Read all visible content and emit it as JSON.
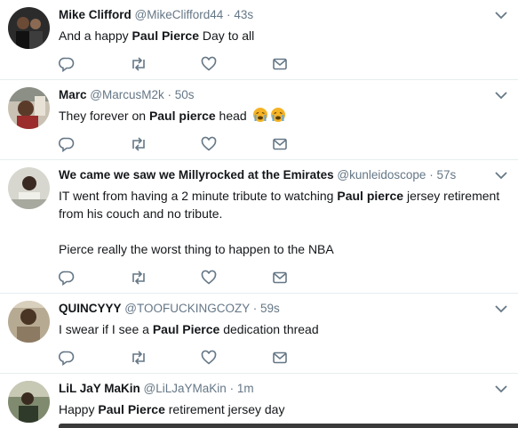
{
  "tweets": [
    {
      "name": "Mike Clifford",
      "handle": "@MikeClifford44",
      "time": "43s",
      "segments": [
        {
          "text": "And a happy ",
          "bold": false
        },
        {
          "text": "Paul Pierce",
          "bold": true
        },
        {
          "text": " Day to all",
          "bold": false
        }
      ]
    },
    {
      "name": "Marc",
      "handle": "@MarcusM2k",
      "time": "50s",
      "segments": [
        {
          "text": "They forever on ",
          "bold": false
        },
        {
          "text": "Paul pierce",
          "bold": true
        },
        {
          "text": " head ",
          "bold": false
        }
      ],
      "emojis": [
        "crying-face-emoji",
        "crying-face-emoji"
      ]
    },
    {
      "name": "We came we saw we Millyrocked at the Emirates",
      "handle": "@kunleidoscope",
      "time": "57s",
      "segments": [
        {
          "text": "IT went from having a 2 minute tribute to watching ",
          "bold": false
        },
        {
          "text": "Paul pierce",
          "bold": true
        },
        {
          "text": " jersey retirement from his couch and no tribute.",
          "bold": false
        }
      ],
      "extra": "Pierce really the worst thing to happen to the NBA"
    },
    {
      "name": "QUINCYYY",
      "handle": "@TOOFUCKINGCOZY",
      "time": "59s",
      "segments": [
        {
          "text": "I swear if I see a ",
          "bold": false
        },
        {
          "text": "Paul Pierce",
          "bold": true
        },
        {
          "text": " dedication thread",
          "bold": false
        }
      ]
    },
    {
      "name": "LiL JaY MaKin",
      "handle": "@LiLJaYMaKin",
      "time": "1m",
      "segments": [
        {
          "text": "Happy ",
          "bold": false
        },
        {
          "text": "Paul Pierce",
          "bold": true
        },
        {
          "text": " retirement jersey day",
          "bold": false
        }
      ]
    }
  ],
  "separator": "·",
  "icons": [
    "reply-icon",
    "retweet-icon",
    "like-icon",
    "direct-message-icon",
    "chevron-down-icon"
  ],
  "colors": {
    "text": "#14171a",
    "muted": "#657786",
    "icon": "#657786",
    "divider": "#e6ecf0"
  }
}
